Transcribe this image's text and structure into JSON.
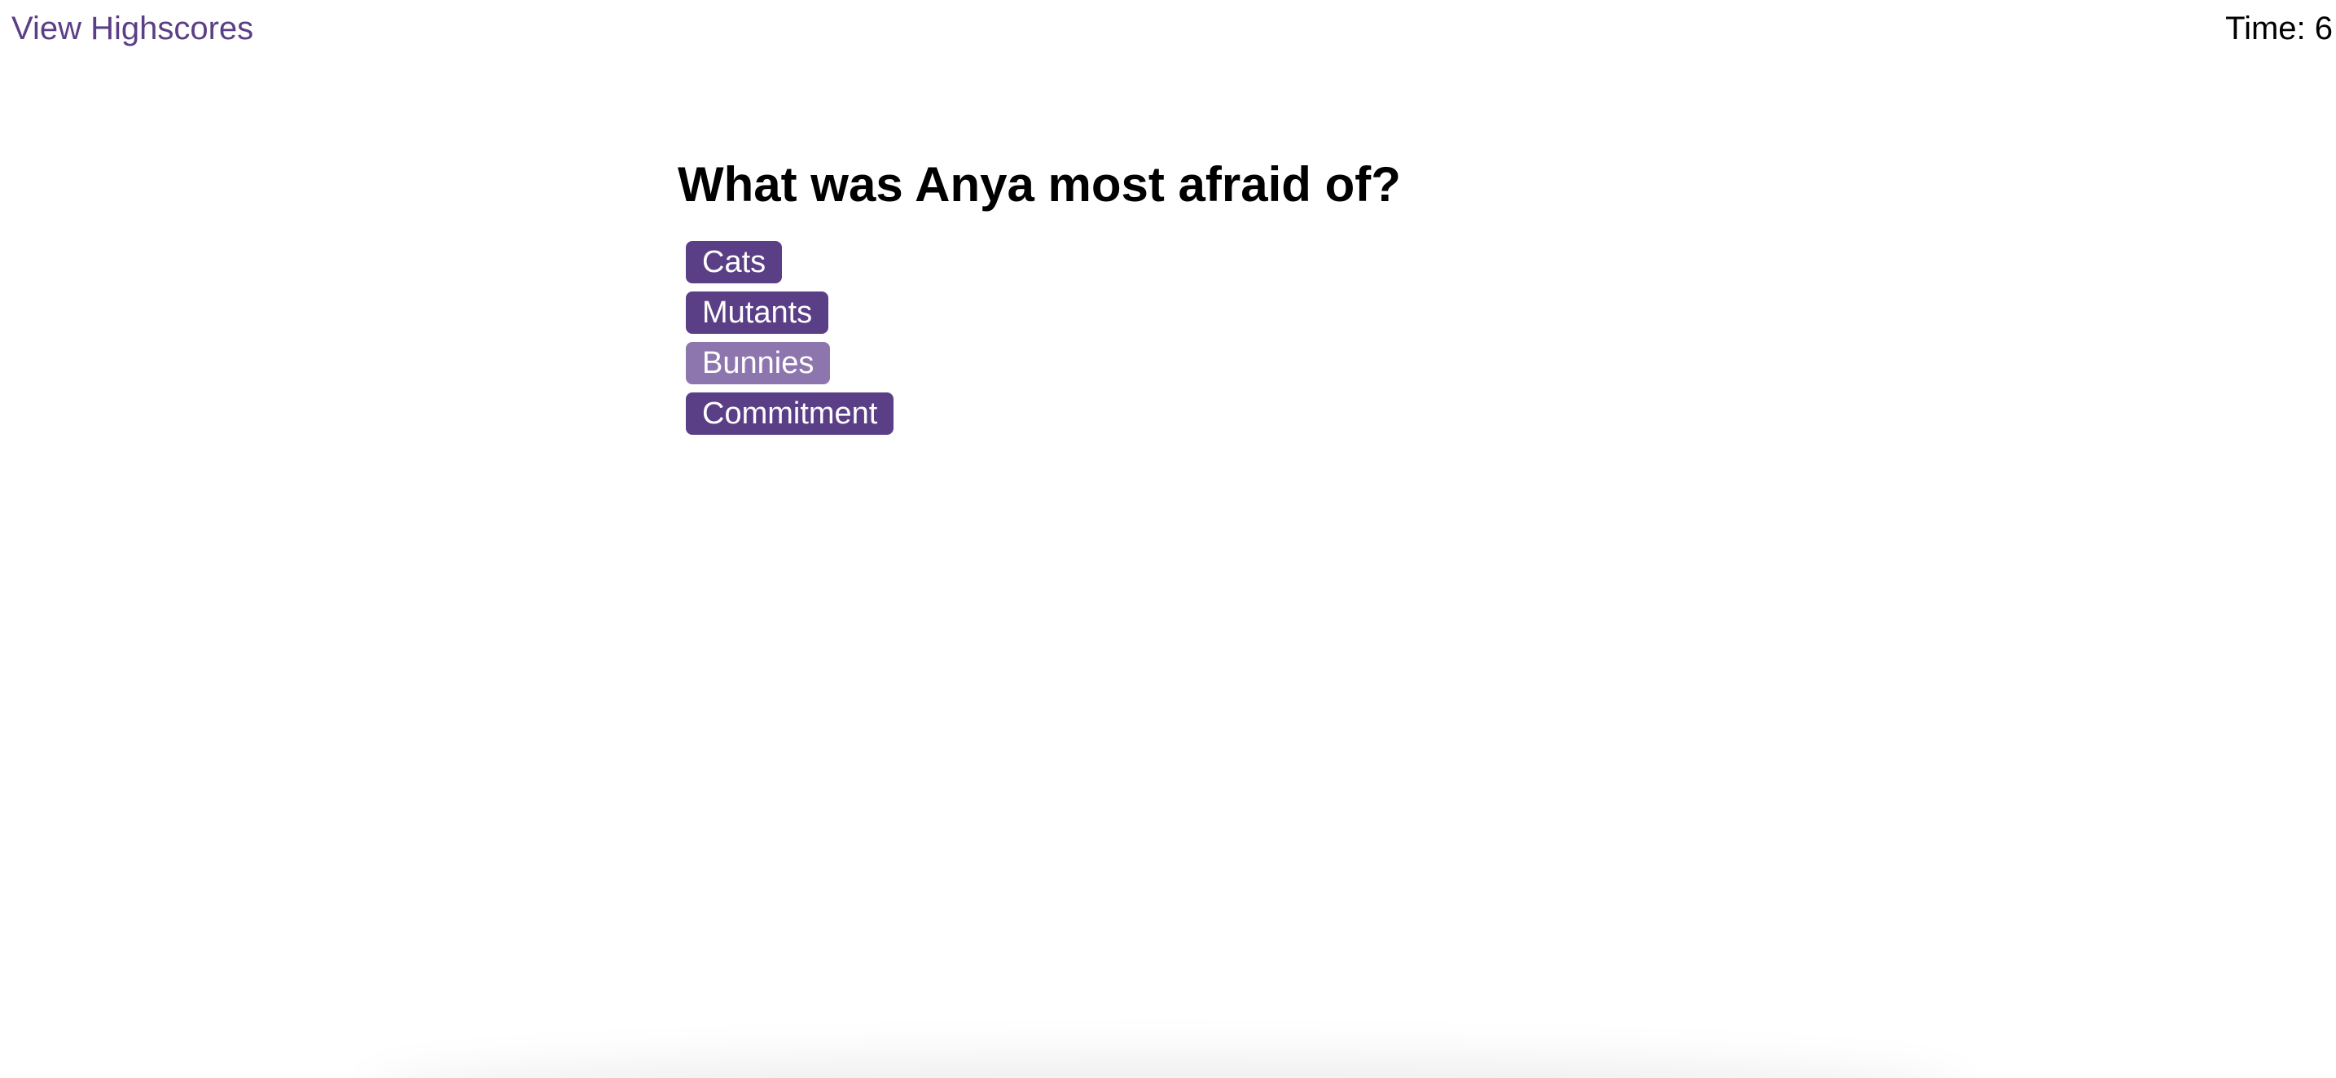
{
  "header": {
    "highscores_link": "View Highscores",
    "timer": "Time: 6"
  },
  "quiz": {
    "question": "What was Anya most afraid of?",
    "choices": [
      {
        "label": "Cats",
        "state": "default"
      },
      {
        "label": "Mutants",
        "state": "default"
      },
      {
        "label": "Bunnies",
        "state": "hovered"
      },
      {
        "label": "Commitment",
        "state": "default"
      }
    ]
  },
  "colors": {
    "accent": "#5b3f86",
    "accent_hover": "#8d76ad",
    "text": "#000000",
    "background": "#ffffff"
  }
}
